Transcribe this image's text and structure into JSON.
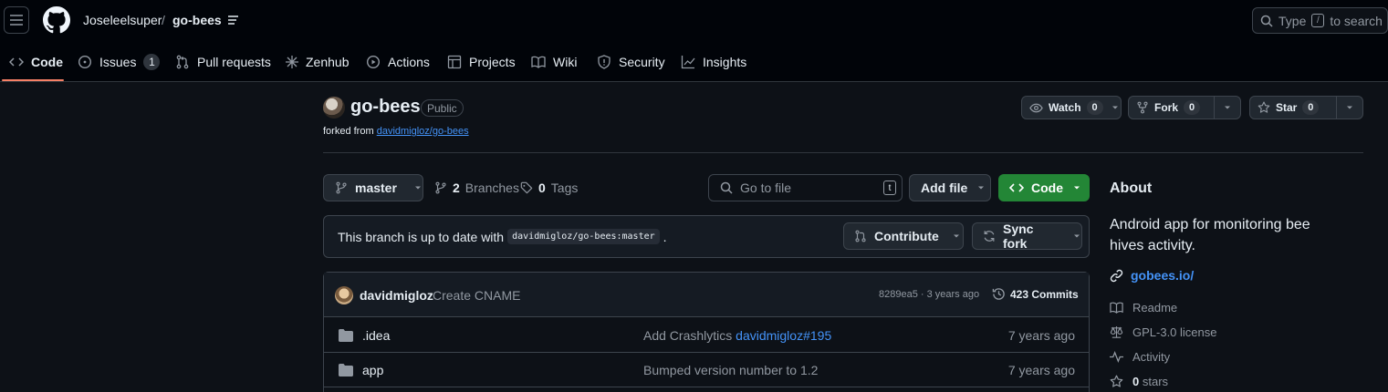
{
  "header": {
    "owner": "Joseleelsuper",
    "separator": "/",
    "repo": "go-bees",
    "search_placeholder_before": "Type",
    "search_key": "/",
    "search_placeholder_after": "to search"
  },
  "nav": {
    "code": "Code",
    "issues": "Issues",
    "issues_count": "1",
    "pull_requests": "Pull requests",
    "zenhub": "Zenhub",
    "actions": "Actions",
    "projects": "Projects",
    "wiki": "Wiki",
    "security": "Security",
    "insights": "Insights"
  },
  "repo": {
    "name": "go-bees",
    "visibility": "Public",
    "forked_prefix": "forked from",
    "forked_from": "davidmigloz/go-bees",
    "watch_label": "Watch",
    "watch_count": "0",
    "fork_label": "Fork",
    "fork_count": "0",
    "star_label": "Star",
    "star_count": "0"
  },
  "toolbar": {
    "branch": "master",
    "branches_count": "2",
    "branches_label": "Branches",
    "tags_count": "0",
    "tags_label": "Tags",
    "goto_placeholder": "Go to file",
    "goto_key": "t",
    "add_file": "Add file",
    "code_button": "Code"
  },
  "branch_status": {
    "text": "This branch is up to date with",
    "ref": "davidmigloz/go-bees:master",
    "period": ".",
    "contribute": "Contribute",
    "sync_fork": "Sync fork"
  },
  "latest_commit": {
    "author": "davidmigloz",
    "message": "Create CNAME",
    "meta": "8289ea5 · 3 years ago",
    "commits_label": "423 Commits"
  },
  "files": [
    {
      "name": ".idea",
      "message": "Add Crashlytics",
      "message_link": "davidmigloz#195",
      "age": "7 years ago"
    },
    {
      "name": "app",
      "message": "Bumped version number to 1.2",
      "message_link": "",
      "age": "7 years ago"
    }
  ],
  "about": {
    "heading": "About",
    "description": "Android app for monitoring bee hives activity.",
    "website": "gobees.io/",
    "readme": "Readme",
    "license": "GPL-3.0 license",
    "activity": "Activity",
    "stars_count": "0",
    "stars_label": "stars"
  },
  "colors": {
    "background": "#0d1117",
    "header_background": "#010409",
    "accent_link": "#4493f8",
    "code_button": "#238636",
    "nav_underline": "#f78166"
  }
}
